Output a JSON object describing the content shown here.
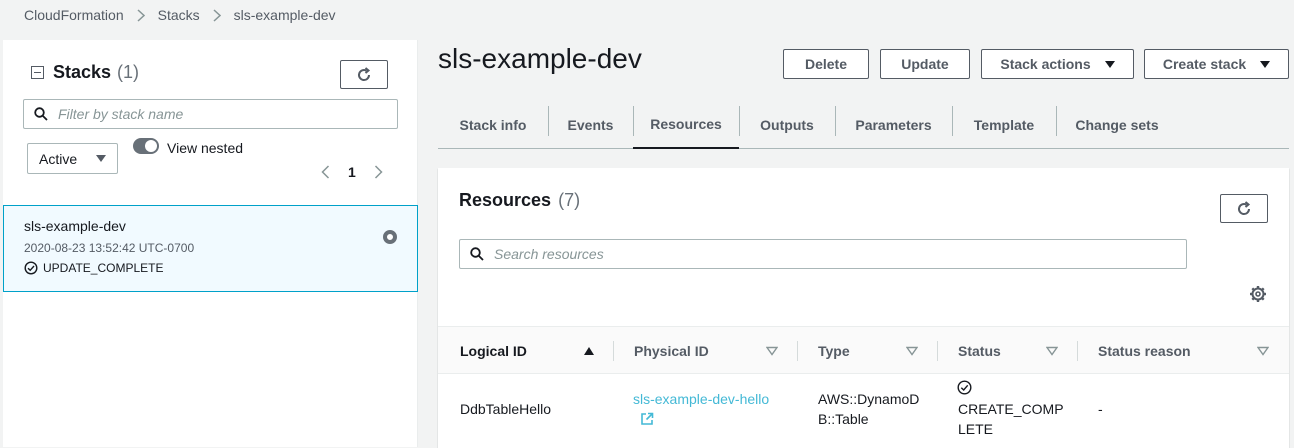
{
  "breadcrumb": {
    "items": [
      "CloudFormation",
      "Stacks",
      "sls-example-dev"
    ]
  },
  "left_panel": {
    "title": "Stacks",
    "count": "(1)",
    "filter_placeholder": "Filter by stack name",
    "filter_select": "Active",
    "toggle_label": "View nested",
    "page": "1",
    "stack": {
      "name": "sls-example-dev",
      "date": "2020-08-23 13:52:42 UTC-0700",
      "status": "UPDATE_COMPLETE"
    }
  },
  "main": {
    "title": "sls-example-dev",
    "buttons": {
      "delete": "Delete",
      "update": "Update",
      "stack_actions": "Stack actions",
      "create_stack": "Create stack"
    },
    "tabs": [
      "Stack info",
      "Events",
      "Resources",
      "Outputs",
      "Parameters",
      "Template",
      "Change sets"
    ],
    "active_tab": "Resources"
  },
  "resources": {
    "title": "Resources",
    "count": "(7)",
    "search_placeholder": "Search resources",
    "columns": [
      "Logical ID",
      "Physical ID",
      "Type",
      "Status",
      "Status reason"
    ],
    "rows": [
      {
        "logical_id": "DdbTableHello",
        "physical_id": "sls-example-dev-hello",
        "type_line1": "AWS::DynamoD",
        "type_line2": "B::Table",
        "status_line1": "CREATE_COMP",
        "status_line2": "LETE",
        "status_reason": "-"
      }
    ]
  },
  "colors": {
    "link": "#44b9d6",
    "selected_bg": "#f1faff",
    "selected_border": "#00a1c9"
  }
}
